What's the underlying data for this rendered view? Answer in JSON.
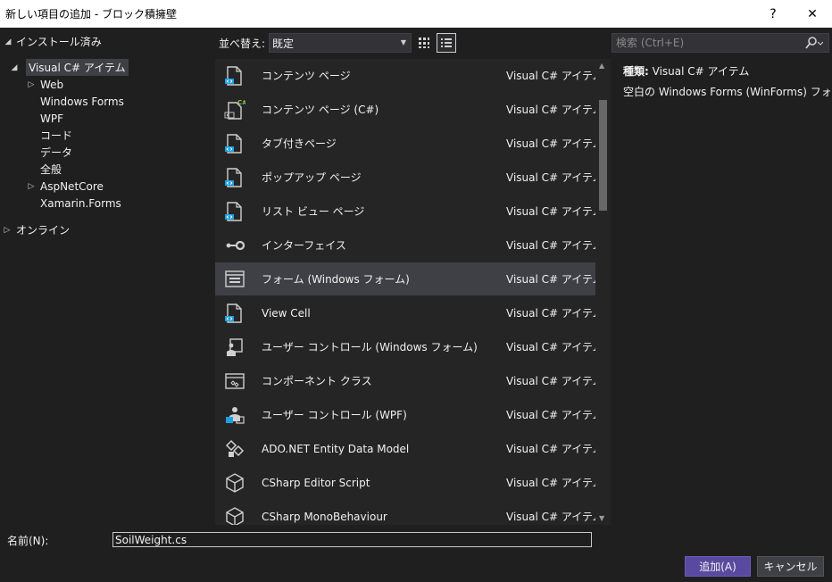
{
  "window": {
    "title": "新しい項目の追加 - ブロック積擁壁",
    "help_glyph": "?",
    "close_glyph": "✕"
  },
  "tree": {
    "installed_label": "インストール済み",
    "visual_csharp_label": "Visual C# アイテム",
    "children": [
      "Web",
      "Windows Forms",
      "WPF",
      "コード",
      "データ",
      "全般",
      "AspNetCore",
      "Xamarin.Forms"
    ],
    "online_label": "オンライン"
  },
  "sortbar": {
    "label": "並べ替え:",
    "value": "既定"
  },
  "items": [
    {
      "name": "コンテンツ ページ",
      "category": "Visual C# アイテム",
      "icon": "content-page-icon"
    },
    {
      "name": "コンテンツ ページ (C#)",
      "category": "Visual C# アイテム",
      "icon": "content-page-csharp-icon"
    },
    {
      "name": "タブ付きページ",
      "category": "Visual C# アイテム",
      "icon": "tabbed-page-icon"
    },
    {
      "name": "ポップアップ ページ",
      "category": "Visual C# アイテム",
      "icon": "popup-page-icon"
    },
    {
      "name": "リスト ビュー ページ",
      "category": "Visual C# アイテム",
      "icon": "list-view-page-icon"
    },
    {
      "name": "インターフェイス",
      "category": "Visual C# アイテム",
      "icon": "interface-icon"
    },
    {
      "name": "フォーム (Windows フォーム)",
      "category": "Visual C# アイテム",
      "icon": "windows-form-icon"
    },
    {
      "name": "View Cell",
      "category": "Visual C# アイテム",
      "icon": "view-cell-icon"
    },
    {
      "name": "ユーザー コントロール (Windows フォーム)",
      "category": "Visual C# アイテム",
      "icon": "user-control-icon"
    },
    {
      "name": "コンポーネント クラス",
      "category": "Visual C# アイテム",
      "icon": "component-class-icon"
    },
    {
      "name": "ユーザー コントロール (WPF)",
      "category": "Visual C# アイテム",
      "icon": "wpf-user-control-icon"
    },
    {
      "name": "ADO.NET Entity Data Model",
      "category": "Visual C# アイテム",
      "icon": "entity-data-model-icon"
    },
    {
      "name": "CSharp Editor Script",
      "category": "Visual C# アイテム",
      "icon": "cube-icon"
    },
    {
      "name": "CSharp MonoBehaviour",
      "category": "Visual C# アイテム",
      "icon": "cube-icon"
    }
  ],
  "selected_item_index": 6,
  "search": {
    "placeholder": "検索 (Ctrl+E)",
    "value": ""
  },
  "details": {
    "type_key": "種類:",
    "type_value": "Visual C# アイテム",
    "description": "空白の Windows Forms (WinForms) フォーム"
  },
  "name_field": {
    "label": "名前(N):",
    "value": "SoilWeight.cs"
  },
  "buttons": {
    "add": "追加(A)",
    "cancel": "キャンセル"
  },
  "colors": {
    "accent": "#5a4a9f",
    "background": "#1f1f1f",
    "list_background": "#252526",
    "selection": "#3f3f46"
  }
}
